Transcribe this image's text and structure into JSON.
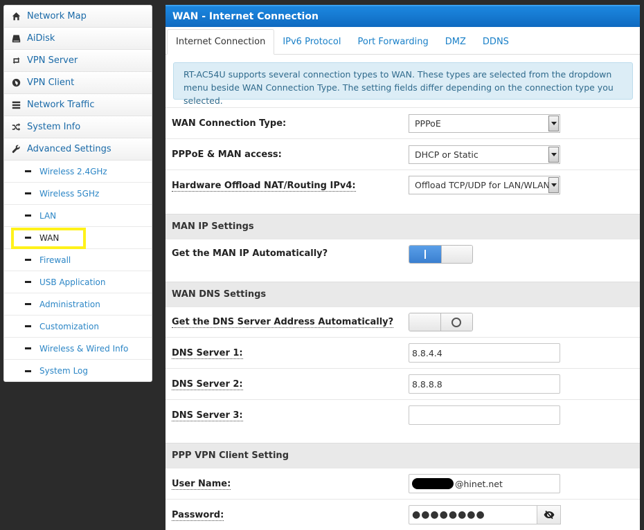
{
  "sidebar": {
    "items": [
      {
        "label": "Network Map",
        "icon": "home-icon"
      },
      {
        "label": "AiDisk",
        "icon": "disk-icon"
      },
      {
        "label": "VPN Server",
        "icon": "retweet-icon"
      },
      {
        "label": "VPN Client",
        "icon": "globe-icon"
      },
      {
        "label": "Network Traffic",
        "icon": "list-icon"
      },
      {
        "label": "System Info",
        "icon": "shuffle-icon"
      },
      {
        "label": "Advanced Settings",
        "icon": "wrench-icon"
      }
    ],
    "subitems": [
      "Wireless 2.4GHz",
      "Wireless 5GHz",
      "LAN",
      "WAN",
      "Firewall",
      "USB Application",
      "Administration",
      "Customization",
      "Wireless & Wired Info",
      "System Log"
    ],
    "active_subitem": "WAN",
    "highlight_color": "#fff21a"
  },
  "main": {
    "title": "WAN - Internet Connection",
    "tabs": [
      "Internet Connection",
      "IPv6 Protocol",
      "Port Forwarding",
      "DMZ",
      "DDNS"
    ],
    "active_tab": "Internet Connection",
    "info_text": "RT-AC54U supports several connection types to WAN. These types are selected from the dropdown menu beside WAN Connection Type. The setting fields differ depending on the connection type you selected.",
    "wan_type_label": "WAN Connection Type:",
    "wan_type_value": "PPPoE",
    "man_access_label": "PPPoE & MAN access:",
    "man_access_value": "DHCP or Static",
    "hw_offload_label": "Hardware Offload NAT/Routing IPv4:",
    "hw_offload_value": "Offload TCP/UDP for LAN/WLAN",
    "man_ip_section": "MAN IP Settings",
    "man_ip_auto_label": "Get the MAN IP Automatically?",
    "man_ip_auto_state": "on",
    "wan_dns_section": "WAN DNS Settings",
    "dns_auto_label": "Get the DNS Server Address Automatically?",
    "dns_auto_state": "off",
    "dns1_label": "DNS Server 1:",
    "dns1_value": "8.8.4.4",
    "dns2_label": "DNS Server 2:",
    "dns2_value": "8.8.8.8",
    "dns3_label": "DNS Server 3:",
    "dns3_value": "",
    "ppp_section": "PPP VPN Client Setting",
    "username_label": "User Name:",
    "username_value": "@hinet.net",
    "password_label": "Password:",
    "password_value": "●●●●●●●●"
  },
  "colors": {
    "header_blue": "#1577d0",
    "link_blue": "#1a80c8",
    "info_bg": "#dcedf6",
    "toggle_on": "#4a8fdc"
  }
}
